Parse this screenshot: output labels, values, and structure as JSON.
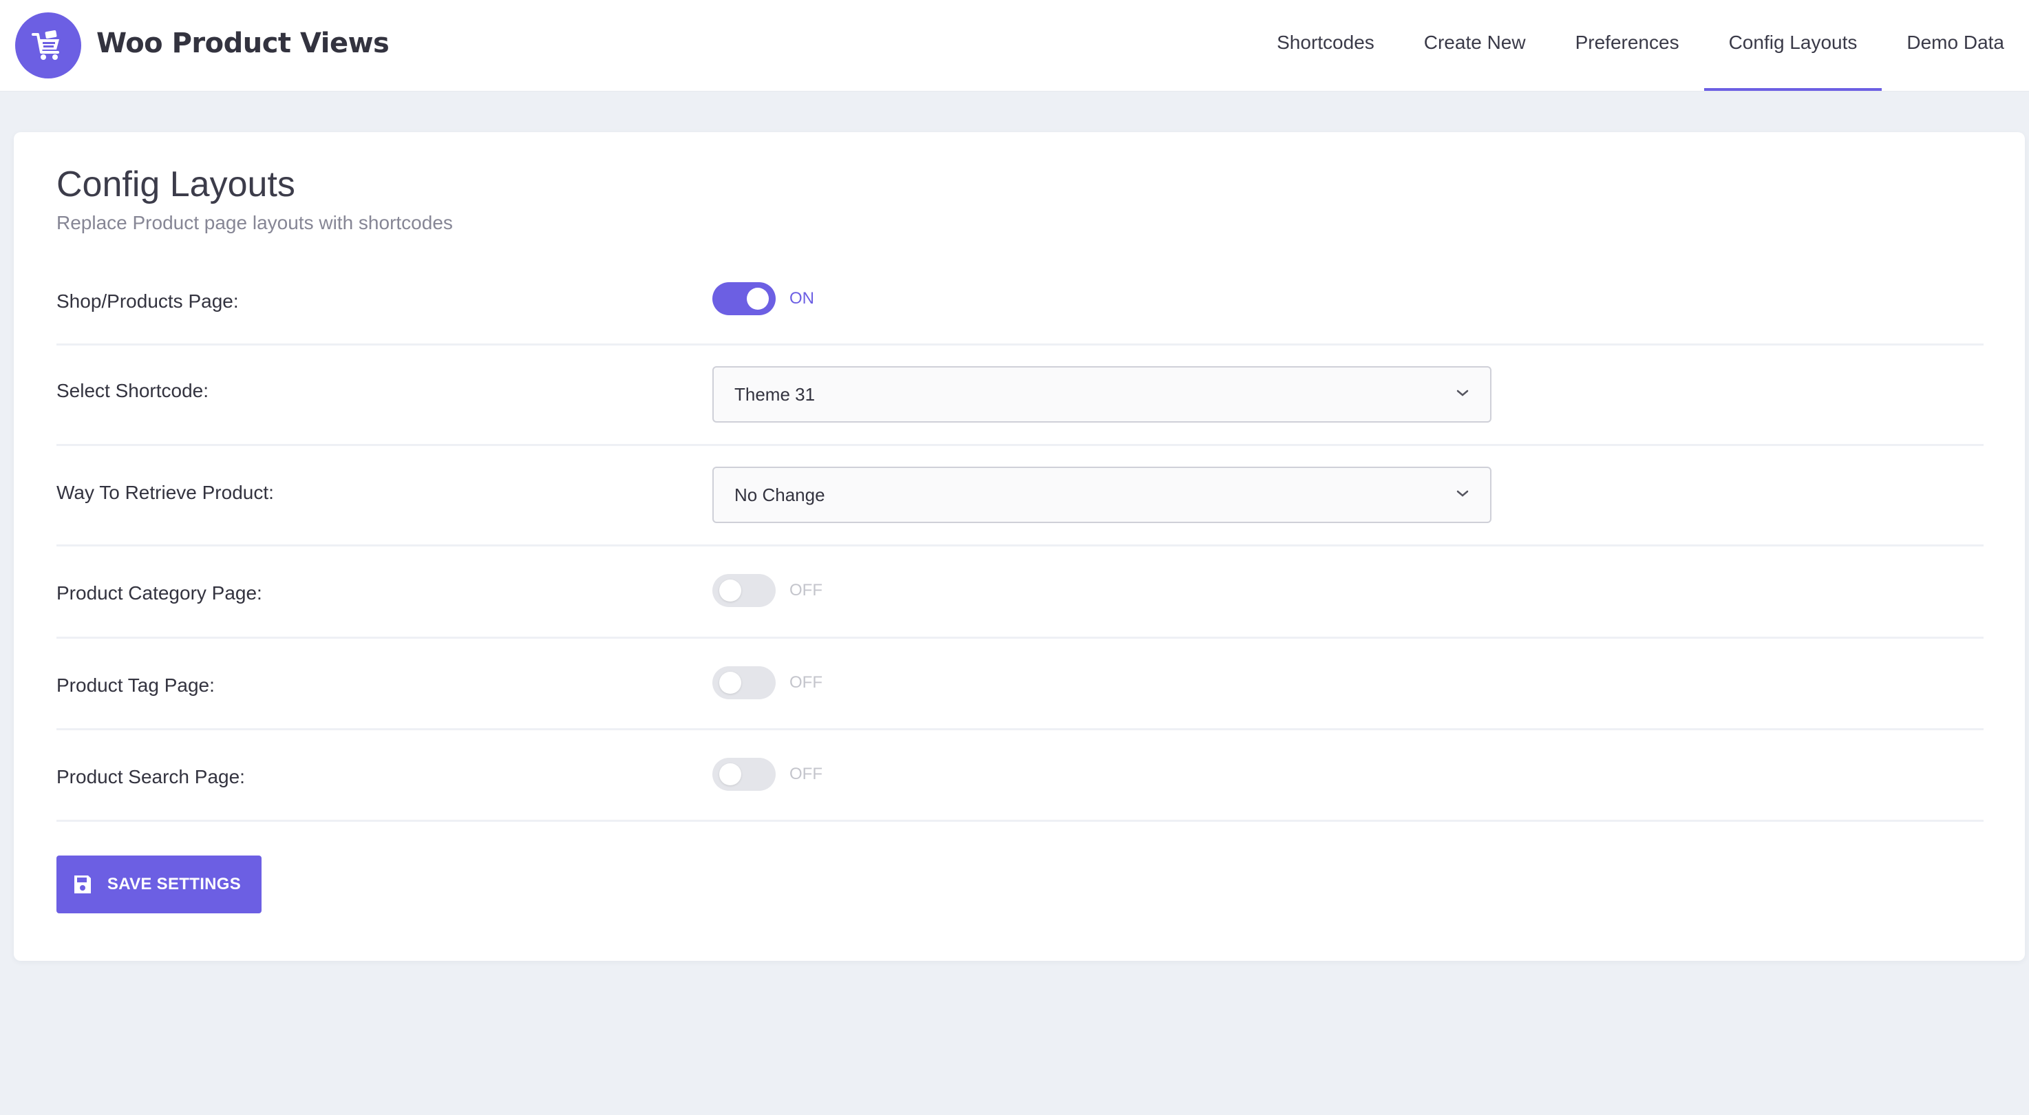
{
  "app": {
    "title": "Woo Product Views",
    "logo_icon": "shopping-cart-icon",
    "accent_color": "#6c5fe3"
  },
  "nav": {
    "items": [
      {
        "label": "Shortcodes",
        "active": false
      },
      {
        "label": "Create New",
        "active": false
      },
      {
        "label": "Preferences",
        "active": false
      },
      {
        "label": "Config Layouts",
        "active": true
      },
      {
        "label": "Demo Data",
        "active": false
      }
    ]
  },
  "page": {
    "title": "Config Layouts",
    "subtitle": "Replace Product page layouts with shortcodes"
  },
  "settings": {
    "shop_page": {
      "label": "Shop/Products Page:",
      "state": "ON",
      "enabled": true
    },
    "select_shortcode": {
      "label": "Select Shortcode:",
      "value": "Theme 31"
    },
    "retrieve_product": {
      "label": "Way To Retrieve Product:",
      "value": "No Change"
    },
    "category_page": {
      "label": "Product Category Page:",
      "state": "OFF",
      "enabled": false
    },
    "tag_page": {
      "label": "Product Tag Page:",
      "state": "OFF",
      "enabled": false
    },
    "search_page": {
      "label": "Product Search Page:",
      "state": "OFF",
      "enabled": false
    }
  },
  "actions": {
    "save_label": "SAVE SETTINGS",
    "save_icon": "floppy-disk-icon"
  }
}
